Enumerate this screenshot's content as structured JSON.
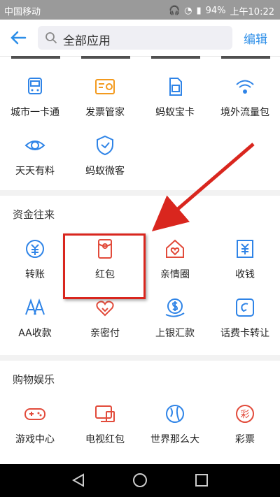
{
  "status": {
    "carrier": "中国移动",
    "battery": "94%",
    "time": "上午10:22"
  },
  "header": {
    "search_text": "全部应用",
    "edit_label": "编辑"
  },
  "rows": [
    {
      "items": [
        {
          "label": "城市一卡通",
          "icon": "transit-card-icon",
          "color": "#2f84e7"
        },
        {
          "label": "发票管家",
          "icon": "invoice-icon",
          "color": "#f39a1e"
        },
        {
          "label": "蚂蚁宝卡",
          "icon": "sim-card-icon",
          "color": "#2f84e7"
        },
        {
          "label": "境外流量包",
          "icon": "wifi-icon",
          "color": "#2f84e7"
        }
      ]
    },
    {
      "items": [
        {
          "label": "天天有料",
          "icon": "eye-icon",
          "color": "#2f84e7"
        },
        {
          "label": "蚂蚁微客",
          "icon": "shield-icon",
          "color": "#2f84e7"
        }
      ]
    }
  ],
  "sections": [
    {
      "title": "资金往来",
      "rows": [
        {
          "items": [
            {
              "label": "转账",
              "icon": "transfer-icon",
              "color": "#2f84e7"
            },
            {
              "label": "红包",
              "icon": "red-envelope-icon",
              "color": "#e24b3b"
            },
            {
              "label": "亲情圈",
              "icon": "family-icon",
              "color": "#e24b3b"
            },
            {
              "label": "收钱",
              "icon": "receive-money-icon",
              "color": "#2f84e7"
            }
          ]
        },
        {
          "items": [
            {
              "label": "AA收款",
              "icon": "aa-icon",
              "color": "#2f84e7"
            },
            {
              "label": "亲密付",
              "icon": "hearts-icon",
              "color": "#e24b3b"
            },
            {
              "label": "上银汇款",
              "icon": "remittance-icon",
              "color": "#2f84e7"
            },
            {
              "label": "话费卡转让",
              "icon": "phone-card-icon",
              "color": "#2f84e7"
            }
          ]
        }
      ]
    },
    {
      "title": "购物娱乐",
      "rows": [
        {
          "items": [
            {
              "label": "游戏中心",
              "icon": "gamepad-icon",
              "color": "#e24b3b"
            },
            {
              "label": "电视红包",
              "icon": "tv-envelope-icon",
              "color": "#e24b3b"
            },
            {
              "label": "世界那么大",
              "icon": "globe-icon",
              "color": "#2f84e7"
            },
            {
              "label": "彩票",
              "icon": "lottery-icon",
              "color": "#e24b3b"
            }
          ]
        }
      ]
    }
  ]
}
